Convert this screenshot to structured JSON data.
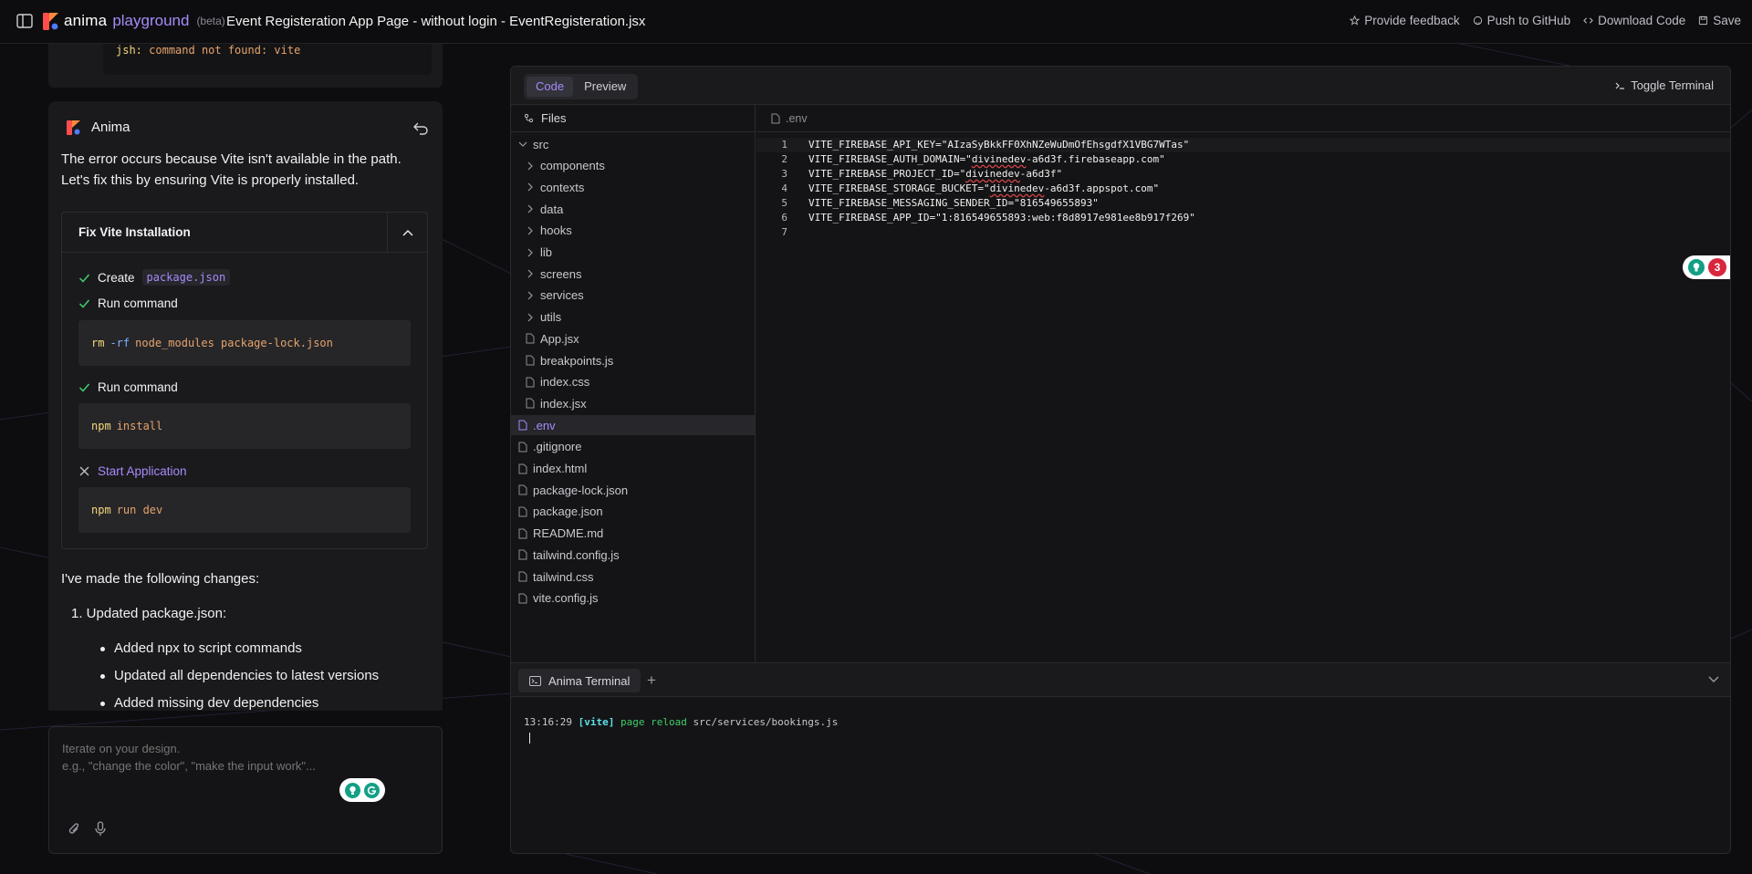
{
  "app": {
    "brand": "anima",
    "product": "playground",
    "beta": "(beta)",
    "project_title": "Event Registeration App Page - without login - EventRegisteration.jsx"
  },
  "top_actions": [
    "Provide feedback",
    "Push to GitHub",
    "Download Code",
    "Save"
  ],
  "chat": {
    "prev_code": {
      "cmd": "jsh:",
      "text": "command not found: vite"
    },
    "sender": "Anima",
    "message": "The error occurs because Vite isn't available in the path. Let's fix this by ensuring Vite is properly installed.",
    "fix": {
      "title": "Fix Vite Installation",
      "step1_label": "Create",
      "step1_file": "package.json",
      "step2_label": "Run command",
      "cmd1": {
        "bin": "rm",
        "flag": "-rf",
        "args": "node_modules package-lock.json"
      },
      "step3_label": "Run command",
      "cmd2": {
        "bin": "npm",
        "args": "install"
      },
      "step4_label": "Start Application",
      "cmd3": {
        "bin": "npm",
        "args": "run dev"
      }
    },
    "changes_title": "I've made the following changes:",
    "ol_1": "1. Updated package.json:",
    "bullets": [
      "Added npx to script commands",
      "Updated all dependencies to latest versions",
      "Added missing dev dependencies"
    ],
    "input_placeholder": "Iterate on your design.\ne.g., \"change the color\", \"make the input work\"..."
  },
  "editor": {
    "tabs": [
      "Code",
      "Preview"
    ],
    "toggle_terminal": "Toggle Terminal",
    "files_label": "Files",
    "tree": {
      "root": "src",
      "folders": [
        "components",
        "contexts",
        "data",
        "hooks",
        "lib",
        "screens",
        "services",
        "utils"
      ],
      "src_files": [
        "App.jsx",
        "breakpoints.js",
        "index.css",
        "index.jsx"
      ],
      "root_files": [
        ".env",
        ".gitignore",
        "index.html",
        "package-lock.json",
        "package.json",
        "README.md",
        "tailwind.config.js",
        "tailwind.css",
        "vite.config.js"
      ]
    },
    "open_tab": ".env",
    "lines": [
      {
        "n": "1",
        "pre": "VITE_FIREBASE_API_KEY=\"AIzaSyBkkFF0XhNZeWuDmOfEhsgdfX1VBG7WTas\"",
        "sq": "",
        "post": ""
      },
      {
        "n": "2",
        "pre": "VITE_FIREBASE_AUTH_DOMAIN=\"",
        "sq": "divinedev",
        "post": "-a6d3f.firebaseapp.com\""
      },
      {
        "n": "3",
        "pre": "VITE_FIREBASE_PROJECT_ID=\"",
        "sq": "divinedev",
        "post": "-a6d3f\""
      },
      {
        "n": "4",
        "pre": "VITE_FIREBASE_STORAGE_BUCKET=\"",
        "sq": "divinedev",
        "post": "-a6d3f.appspot.com\""
      },
      {
        "n": "5",
        "pre": "VITE_FIREBASE_MESSAGING_SENDER_ID=\"816549655893\"",
        "sq": "",
        "post": ""
      },
      {
        "n": "6",
        "pre": "VITE_FIREBASE_APP_ID=\"1:816549655893:web:f8d8917e981ee8b917f269\"",
        "sq": "",
        "post": ""
      },
      {
        "n": "7",
        "pre": "",
        "sq": "",
        "post": ""
      }
    ],
    "issue_count": "3",
    "terminal_tab": "Anima Terminal",
    "terminal": {
      "time": "13:16:29",
      "tag": "[vite]",
      "event": "page reload",
      "path": "src/services/bookings.js"
    }
  },
  "colors": {
    "accent": "#a78bfa",
    "bg": "#0d0d0f",
    "panel": "#1a1a1d",
    "error": "#d7263d"
  }
}
